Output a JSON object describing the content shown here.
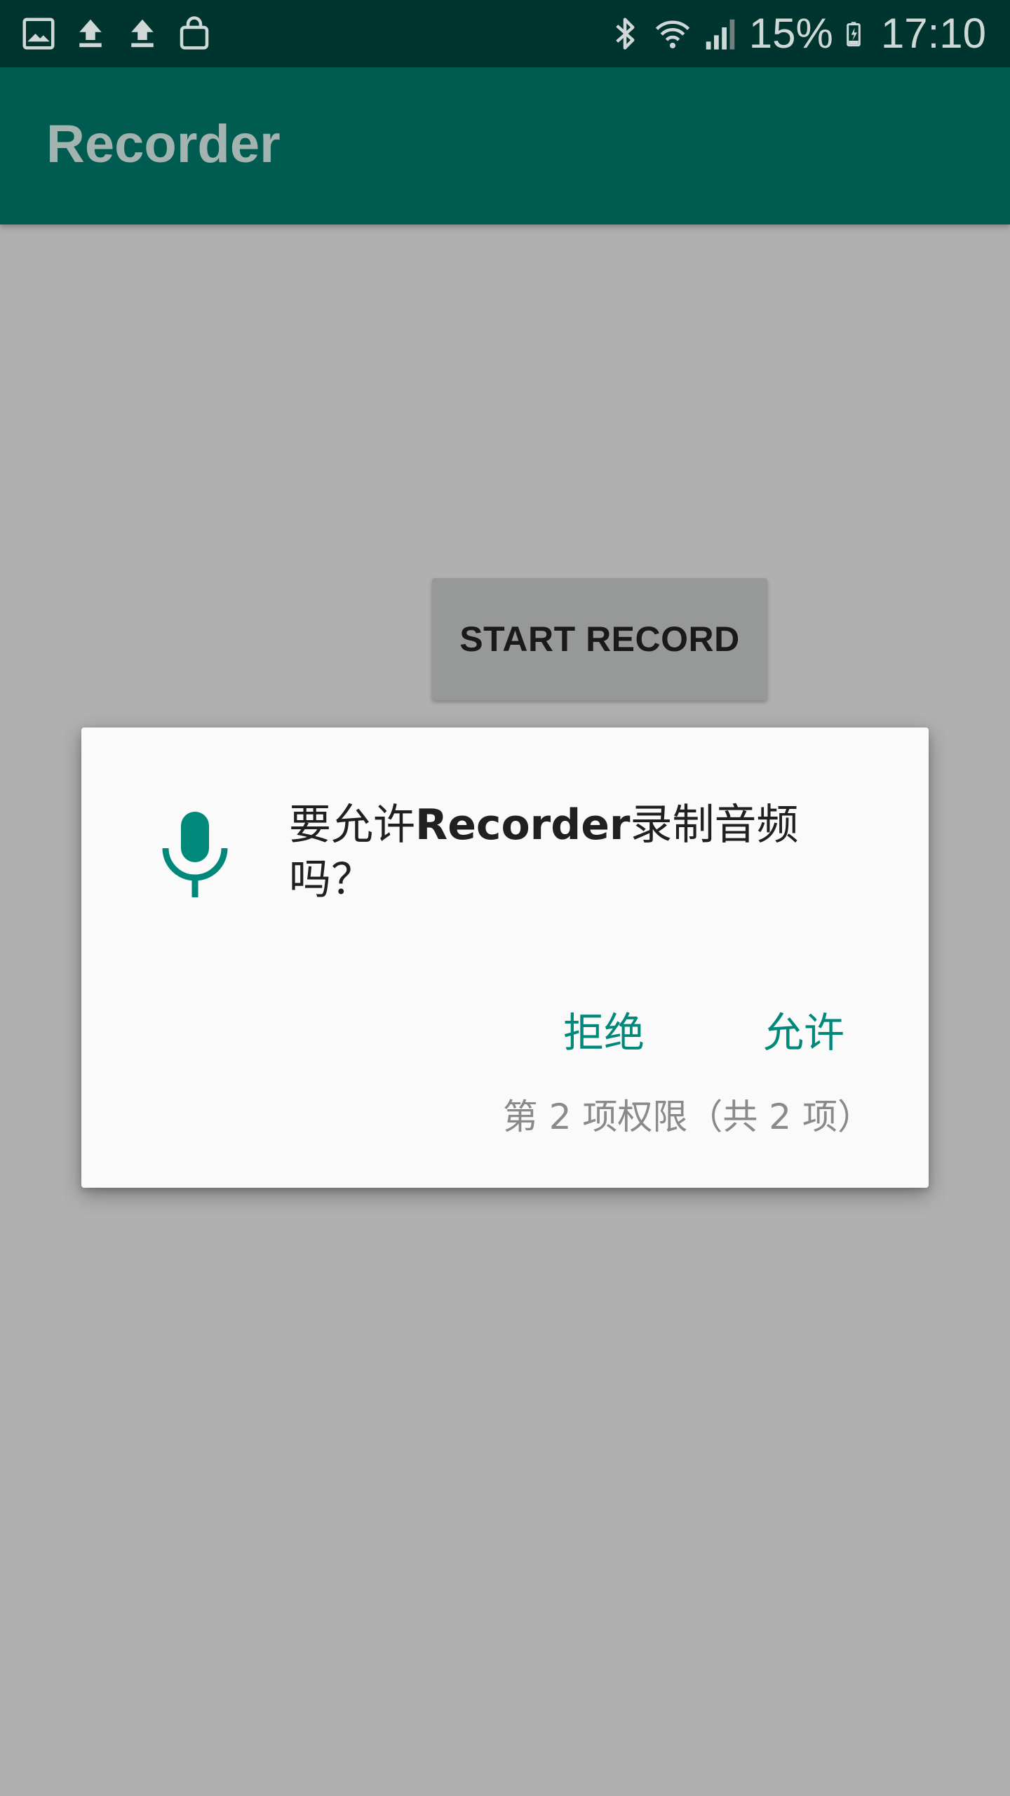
{
  "status_bar": {
    "icons_left": [
      "gallery-icon",
      "upload-icon",
      "upload-icon",
      "shopping-bag-icon"
    ],
    "icons_right": [
      "bluetooth-icon",
      "wifi-icon",
      "signal-icon",
      "battery-charging-icon"
    ],
    "battery_text": "15%",
    "time": "17:10"
  },
  "app_bar": {
    "title": "Recorder"
  },
  "main": {
    "start_button_label": "START RECORD"
  },
  "dialog": {
    "icon": "microphone-icon",
    "message_prefix": "要允许",
    "message_app": "Recorder",
    "message_suffix": "录制音频吗？",
    "deny_label": "拒绝",
    "allow_label": "允许",
    "counter_text": "第 2 项权限（共 2 项）"
  },
  "colors": {
    "status_bar": "#00352f",
    "app_bar": "#005b51",
    "accent": "#00897b",
    "scrim_background": "#b0b0b0",
    "dialog_background": "#fafafa"
  }
}
